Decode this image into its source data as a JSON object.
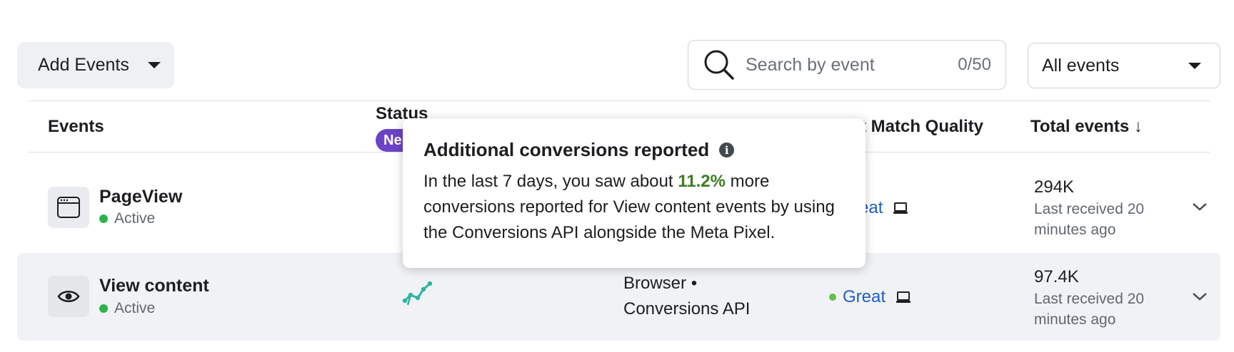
{
  "toolbar": {
    "add_events_label": "Add Events",
    "search_placeholder": "Search by event",
    "search_counter": "0/50",
    "filter_label": "All events"
  },
  "table": {
    "headers": {
      "events": "Events",
      "status": "Status",
      "status_badge": "Ne",
      "emq": "t Match Quality",
      "total": "Total events ↓"
    },
    "rows": [
      {
        "name": "PageView",
        "status": "Active",
        "icon": "browser-window-icon",
        "emq": "eat",
        "total": "294K",
        "last_received": "Last received 20 minutes ago"
      },
      {
        "name": "View content",
        "status": "Active",
        "icon": "eye-icon",
        "source_line1": "Browser •",
        "source_line2": "Conversions API",
        "emq": "Great",
        "total": "97.4K",
        "last_received": "Last received 20 minutes ago"
      }
    ]
  },
  "tooltip": {
    "title": "Additional conversions reported",
    "body_pre": "In the last 7 days, you saw about ",
    "percent": "11.2%",
    "body_post": " more conversions reported for View content events by using the Conversions API alongside the Meta Pixel."
  },
  "colors": {
    "badge": "#6b44c6",
    "active_dot": "#2db34a",
    "link": "#1f5fbf",
    "percent": "#3b7d23",
    "trend": "#2bb5a0"
  }
}
